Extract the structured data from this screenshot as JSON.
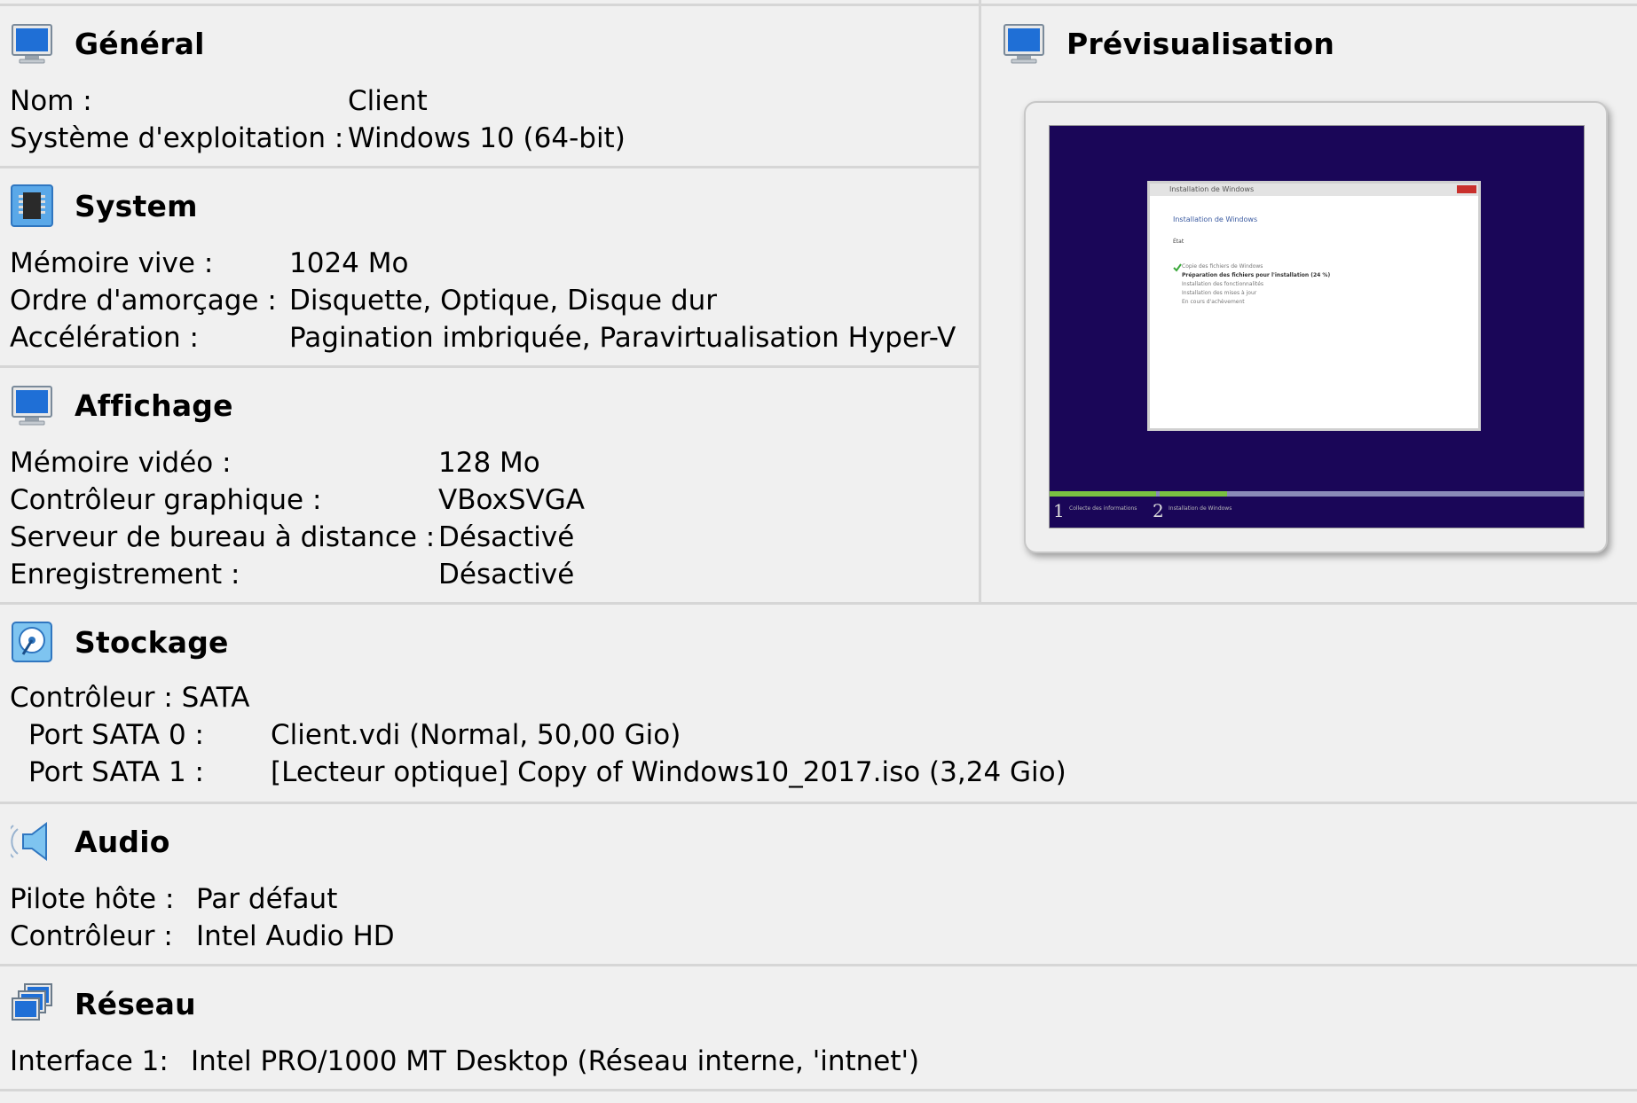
{
  "general": {
    "title": "Général",
    "rows": [
      {
        "label": "Nom :",
        "value": "Client"
      },
      {
        "label": "Système d'exploitation :",
        "value": "Windows 10 (64-bit)"
      }
    ]
  },
  "system": {
    "title": "System",
    "rows": [
      {
        "label": "Mémoire vive :",
        "value": "1024 Mo"
      },
      {
        "label": "Ordre d'amorçage :",
        "value": "Disquette, Optique, Disque dur"
      },
      {
        "label": "Accélération :",
        "value": "Pagination imbriquée, Paravirtualisation Hyper-V"
      }
    ]
  },
  "display": {
    "title": "Affichage",
    "rows": [
      {
        "label": "Mémoire vidéo :",
        "value": "128 Mo"
      },
      {
        "label": "Contrôleur graphique :",
        "value": "VBoxSVGA"
      },
      {
        "label": "Serveur de bureau à distance :",
        "value": "Désactivé"
      },
      {
        "label": "Enregistrement :",
        "value": "Désactivé"
      }
    ]
  },
  "preview": {
    "title": "Prévisualisation",
    "screen": {
      "window_title": "Installation de Windows",
      "heading": "Installation de Windows",
      "status": "État",
      "steps": [
        "Copie des fichiers de Windows",
        "Préparation des fichiers pour l'installation (24 %)",
        "Installation des fonctionnalités",
        "Installation des mises à jour",
        "En cours d'achèvement"
      ],
      "bottom_step_1_num": "1",
      "bottom_step_1": "Collecte des informations",
      "bottom_step_2_num": "2",
      "bottom_step_2": "Installation de Windows"
    }
  },
  "storage": {
    "title": "Stockage",
    "controller": "Contrôleur : SATA",
    "rows": [
      {
        "label": "Port SATA 0 :",
        "value": "Client.vdi (Normal, 50,00 Gio)"
      },
      {
        "label": "Port SATA 1 :",
        "value": "[Lecteur optique] Copy of Windows10_2017.iso (3,24 Gio)"
      }
    ]
  },
  "audio": {
    "title": "Audio",
    "rows": [
      {
        "label": "Pilote hôte :",
        "value": "Par défaut"
      },
      {
        "label": "Contrôleur :",
        "value": "Intel Audio HD"
      }
    ]
  },
  "network": {
    "title": "Réseau",
    "rows": [
      {
        "label": "Interface 1:",
        "value": "Intel PRO/1000 MT Desktop (Réseau interne, 'intnet')"
      }
    ]
  },
  "icons": {
    "general": "monitor-icon",
    "system": "chip-icon",
    "display": "monitor-icon",
    "preview": "monitor-icon",
    "storage": "hard-disk-icon",
    "audio": "speaker-icon",
    "network": "network-icon"
  },
  "colors": {
    "background": "#f0f0f0",
    "separator": "#d6d6d6",
    "icon_blue": "#1f6fd6",
    "preview_screen": "#1a0658"
  }
}
